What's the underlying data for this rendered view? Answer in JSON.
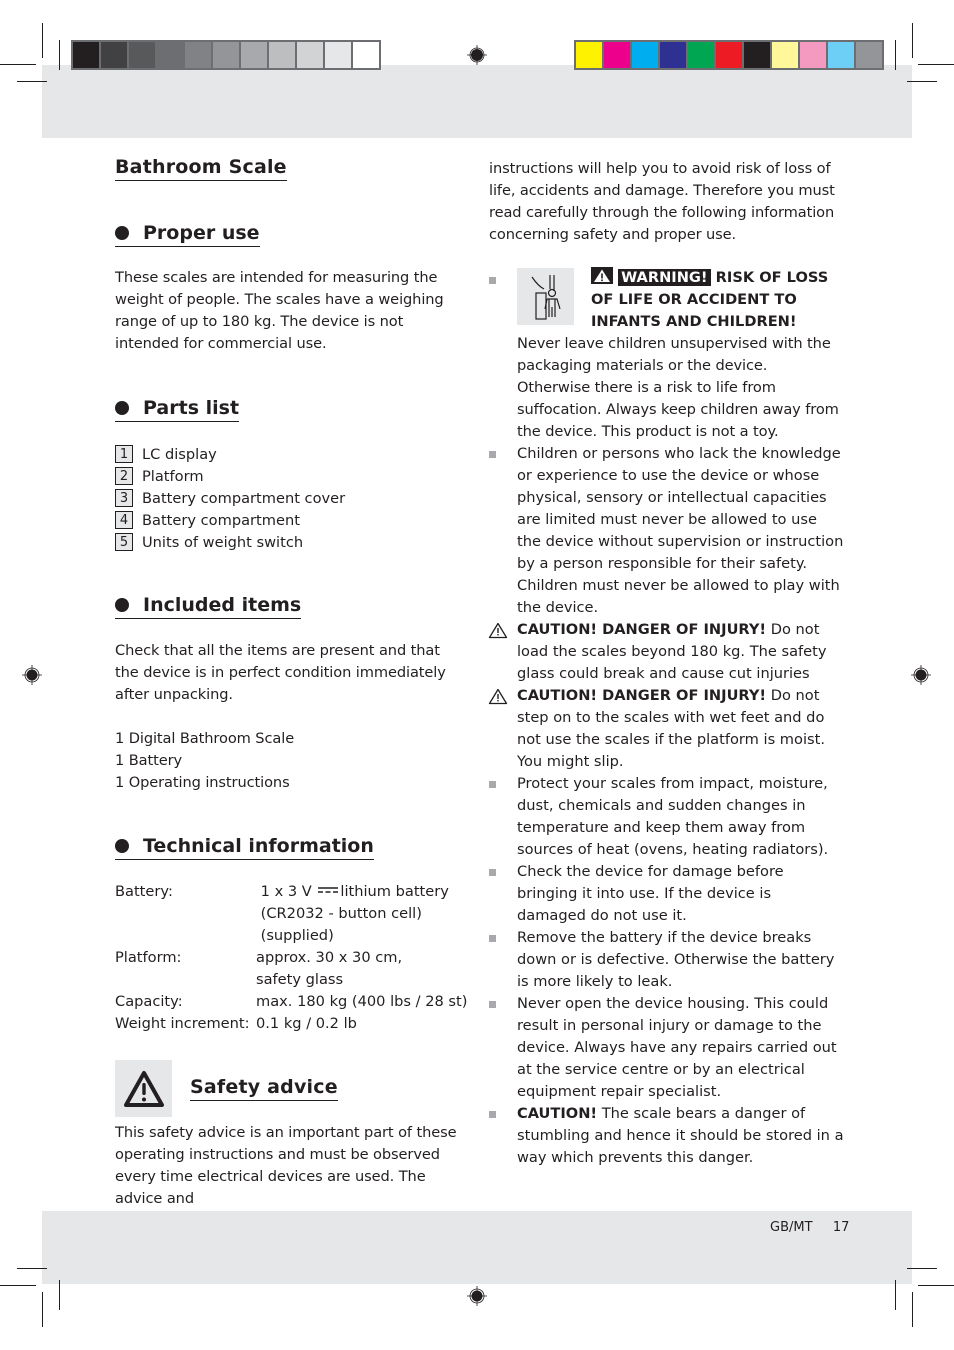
{
  "print_marks": {
    "grayscale_swatches": [
      "#231f20",
      "#414042",
      "#58595b",
      "#6d6e71",
      "#808285",
      "#939598",
      "#a7a9ac",
      "#bcbec0",
      "#d1d3d4",
      "#e6e7e8",
      "#ffffff"
    ],
    "color_swatches": [
      "#fff200",
      "#ec008c",
      "#00aeef",
      "#2e3192",
      "#00a651",
      "#ed1c24",
      "#231f20",
      "#fff799",
      "#f49ac1",
      "#6dcff6",
      "#939598"
    ],
    "registration_icon": "registration-mark-icon"
  },
  "left_column": {
    "page_title": "Bathroom Scale",
    "proper_use": {
      "heading": "Proper use",
      "text": "These scales are intended for measuring the weight of people. The scales have a weighing range of up to 180 kg. The device is not intended for commercial use."
    },
    "parts_list": {
      "heading": "Parts list",
      "items": [
        {
          "number": "1",
          "label": "LC display"
        },
        {
          "number": "2",
          "label": "Platform"
        },
        {
          "number": "3",
          "label": "Battery compartment cover"
        },
        {
          "number": "4",
          "label": "Battery compartment"
        },
        {
          "number": "5",
          "label": "Units of weight switch"
        }
      ]
    },
    "included_items": {
      "heading": "Included items",
      "intro": "Check that all the items are present and that the device is in perfect condition immediately after unpacking.",
      "items": [
        "1 Digital Bathroom Scale",
        "1 Battery",
        "1 Operating instructions"
      ]
    },
    "technical_information": {
      "heading": "Technical information",
      "rows": [
        {
          "label": "Battery:",
          "value_lines": [
            "1 x 3 V",
            "lithium battery",
            "(CR2032 - button cell)",
            "(supplied)"
          ]
        },
        {
          "label": "Platform:",
          "value_lines": [
            "approx. 30 x 30 cm,",
            "safety glass"
          ]
        },
        {
          "label": "Capacity:",
          "value_lines": [
            "max. 180 kg (400 lbs / 28 st)"
          ]
        },
        {
          "label": "Weight increment:",
          "value_lines": [
            "0.1 kg / 0.2 lb"
          ]
        }
      ],
      "dc_symbol_icon": "direct-current-icon"
    },
    "safety_advice": {
      "heading": "Safety advice",
      "icon": "warning-triangle-icon",
      "text": "This safety advice is an important part of these operating instructions and must be observed every time electrical devices are used. The advice and"
    }
  },
  "right_column": {
    "continued_text": "instructions will help you to avoid risk of loss of life, accidents and damage. Therefore you must read carefully through the following information concerning safety and proper use.",
    "child_warning": {
      "icon": "child-safety-icon",
      "warning_label": "WARNING!",
      "headline": "RISK OF LOSS OF LIFE OR ACCIDENT TO INFANTS AND CHILDREN!",
      "text": "Never leave children unsupervised with the packaging materials or the device. Otherwise there is a risk to life from suffocation. Always keep children away from the device. This product is not a toy."
    },
    "bullets": [
      {
        "type": "square",
        "bold": "",
        "text": "Children or persons who lack the knowledge or experience to use the device or whose physical, sensory or intellectual capacities are limited must never be allowed to use the device without supervision or instruction by a person responsible for their safety. Children must never be allowed to play with the device."
      },
      {
        "type": "caution",
        "bold": "CAUTION! DANGER OF INJURY!",
        "text": " Do not load the scales beyond 180 kg. The safety glass could break and cause cut injuries"
      },
      {
        "type": "caution",
        "bold": "CAUTION! DANGER OF INJURY!",
        "text": " Do not step on to the scales with wet feet and do not use the scales if the platform is moist. You might slip."
      },
      {
        "type": "square",
        "bold": "",
        "text": "Protect your scales from impact, moisture, dust, chemicals and sudden changes in temperature and keep them away from sources of heat (ovens, heating radiators)."
      },
      {
        "type": "square",
        "bold": "",
        "text": "Check the device for damage before bringing it into use. If the device is damaged do not use it."
      },
      {
        "type": "square",
        "bold": "",
        "text": "Remove the battery if the device breaks down or is defective. Otherwise the battery is more likely to leak."
      },
      {
        "type": "square",
        "bold": "",
        "text": "Never open the device housing. This could result in personal injury or damage to the device. Always have any repairs carried out at the service centre or by an electrical equipment repair specialist."
      },
      {
        "type": "square",
        "bold": "CAUTION!",
        "text": " The scale bears a danger of stumbling and hence it should be stored in a way which prevents this danger."
      }
    ]
  },
  "footer": {
    "locale": "GB/MT",
    "page_number": "17"
  }
}
